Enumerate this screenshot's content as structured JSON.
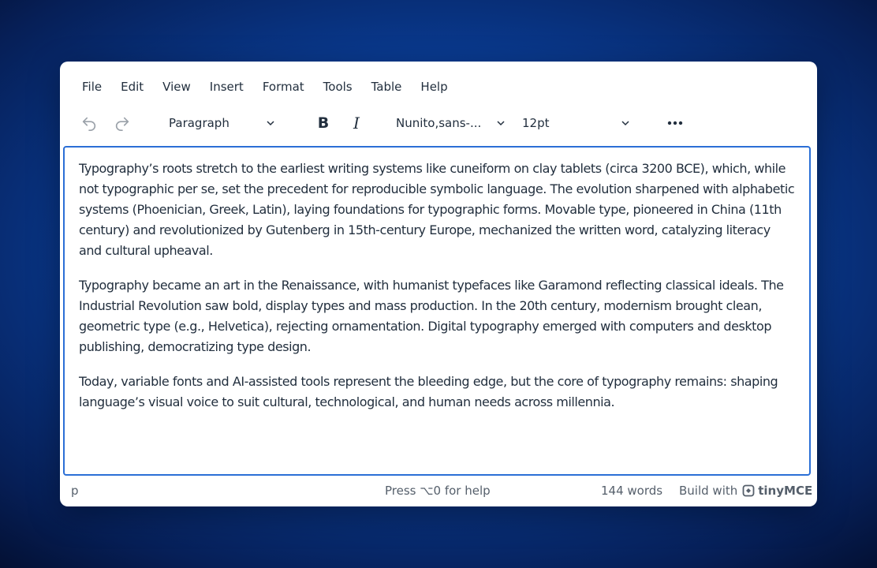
{
  "menubar": {
    "items": [
      "File",
      "Edit",
      "View",
      "Insert",
      "Format",
      "Tools",
      "Table",
      "Help"
    ]
  },
  "toolbar": {
    "block_format": "Paragraph",
    "font_family": "Nunito,sans-...",
    "font_size": "12pt",
    "bold_label": "B",
    "italic_label": "I"
  },
  "content": {
    "paragraphs": [
      "Typography’s roots stretch to the earliest writing systems like cuneiform on clay tablets (circa 3200 BCE), which, while not typographic per se, set the precedent for reproducible symbolic language. The evolution sharpened with alphabetic systems (Phoenician, Greek, Latin), laying foundations for typographic forms. Movable type, pioneered in China (11th century) and revolutionized by Gutenberg in 15th-century Europe, mechanized the written word, catalyzing literacy and cultural upheaval.",
      "Typography became an art in the Renaissance, with humanist typefaces like Garamond reflecting classical ideals. The Industrial Revolution saw bold, display types and mass production. In the 20th century, modernism brought clean, geometric type (e.g., Helvetica), rejecting ornamentation. Digital typography emerged with computers and desktop publishing, democratizing type design.",
      "Today, variable fonts and AI-assisted tools represent the bleeding edge, but the core of typography remains: shaping language’s visual voice to suit cultural, technological, and human needs across millennia."
    ]
  },
  "statusbar": {
    "path": "p",
    "help": "Press ⌥0 for help",
    "word_count": "144 words",
    "build_with": "Build with",
    "brand": "tinyMCE"
  },
  "colors": {
    "accent": "#2b6fd6",
    "text": "#222f3e",
    "muted": "#555f6b",
    "disabled": "#9aa1a9"
  },
  "icons": {
    "undo": "undo-icon",
    "redo": "redo-icon",
    "more": "more-horizontal-icon",
    "chevron": "chevron-down-icon",
    "logo": "tinymce-logo-icon"
  }
}
